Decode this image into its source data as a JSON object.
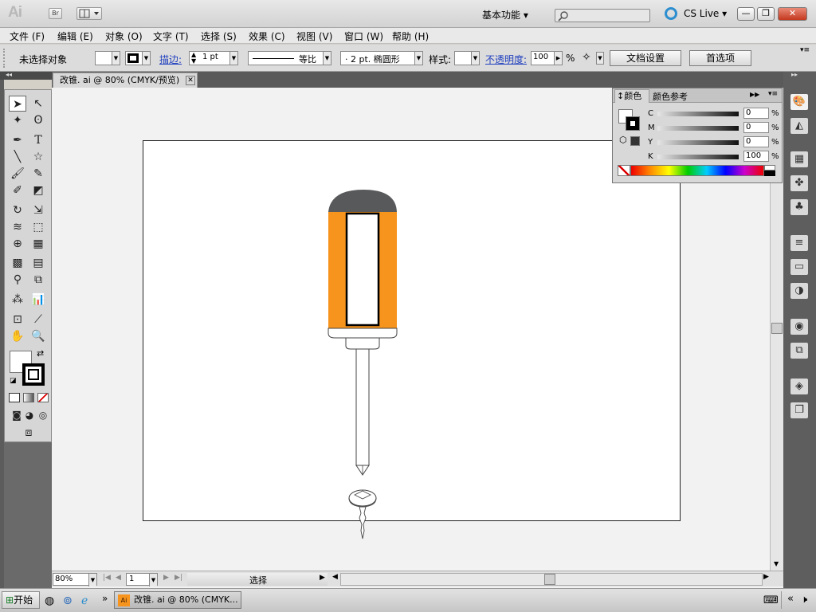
{
  "app": {
    "logo": "Ai",
    "bridge_label": "Br",
    "workspace": "基本功能",
    "cs_live": "CS Live",
    "minimize": "—",
    "restore": "❐",
    "close": "✕"
  },
  "menu": [
    "文件 (F)",
    "编辑 (E)",
    "对象 (O)",
    "文字 (T)",
    "选择 (S)",
    "效果 (C)",
    "视图 (V)",
    "窗口 (W)",
    "帮助 (H)"
  ],
  "control": {
    "no_selection": "未选择对象",
    "stroke_label": "描边:",
    "stroke_value": "1 pt",
    "profile": "等比",
    "brush": "· 2 pt. 椭圆形",
    "style_label": "样式:",
    "opacity_label": "不透明度:",
    "opacity_value": "100",
    "percent": "%",
    "doc_setup": "文档设置",
    "preferences": "首选项"
  },
  "document": {
    "tab_title": "改锥. ai @ 80% (CMYK/预览)",
    "zoom": "80%",
    "page": "1",
    "status": "选择"
  },
  "color_panel": {
    "tab_color": "颜色",
    "tab_guide": "颜色参考",
    "channels": [
      {
        "label": "C",
        "value": "0"
      },
      {
        "label": "M",
        "value": "0"
      },
      {
        "label": "Y",
        "value": "0"
      },
      {
        "label": "K",
        "value": "100"
      }
    ],
    "percent": "%"
  },
  "taskbar": {
    "start": "开始",
    "task": "改锥. ai @ 80% (CMYK..."
  },
  "colors": {
    "handle_orange": "#f7941d",
    "cap_gray": "#58595b",
    "dock_dark": "#5e5e5e"
  }
}
